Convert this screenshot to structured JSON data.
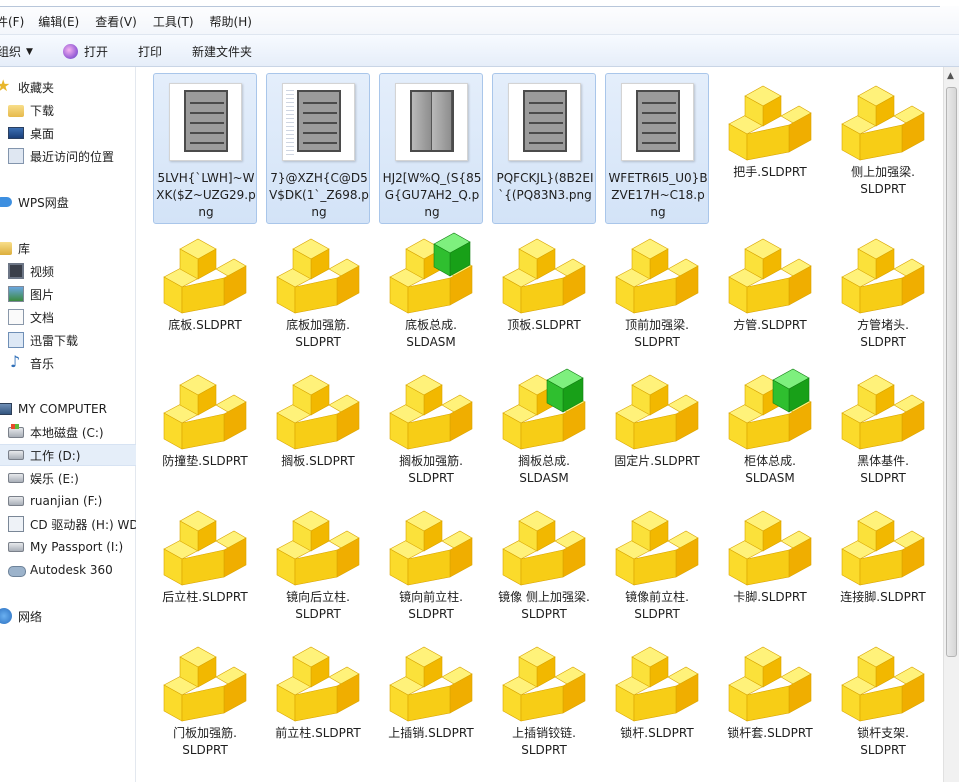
{
  "menu": [
    "件(F)",
    "编辑(E)",
    "查看(V)",
    "工具(T)",
    "帮助(H)"
  ],
  "toolbar": {
    "organize": "组织",
    "open": "打开",
    "print": "打印",
    "new_folder": "新建文件夹"
  },
  "nav": {
    "favorites": "收藏夹",
    "downloads": "下载",
    "desktop": "桌面",
    "recent": "最近访问的位置",
    "wps": "WPS网盘",
    "libraries": "库",
    "video": "视频",
    "pictures": "图片",
    "documents": "文档",
    "thunder": "迅雷下载",
    "music": "音乐",
    "computer": "MY COMPUTER",
    "drive_c": "本地磁盘 (C:)",
    "drive_d": "工作 (D:)",
    "drive_e": "娱乐 (E:)",
    "drive_f": "ruanjian (F:)",
    "drive_h": "CD 驱动器 (H:) WD",
    "drive_i": "My Passport (I:)",
    "autodesk": "Autodesk 360",
    "network": "网络"
  },
  "files": [
    {
      "name": "5LVH{`LWH]~WXK($Z~UZG29.png",
      "type": "png"
    },
    {
      "name": "7}@XZH{C@D5V$DK(1`_Z698.png",
      "type": "png"
    },
    {
      "name": "HJ2[W%Q_(S{85G{GU7AH2_Q.png",
      "type": "png"
    },
    {
      "name": "PQFCKJL}(8B2EI`{(PQ83N3.png",
      "type": "png"
    },
    {
      "name": "WFETR6I5_U0}BZVE17H~C18.png",
      "type": "png"
    },
    {
      "name": "把手.SLDPRT",
      "type": "part"
    },
    {
      "name": "侧上加强梁.SLDPRT",
      "type": "part"
    },
    {
      "name": "底板.SLDPRT",
      "type": "part"
    },
    {
      "name": "底板加强筋.SLDPRT",
      "type": "part"
    },
    {
      "name": "底板总成.SLDASM",
      "type": "asm"
    },
    {
      "name": "顶板.SLDPRT",
      "type": "part"
    },
    {
      "name": "顶前加强梁.SLDPRT",
      "type": "part"
    },
    {
      "name": "方管.SLDPRT",
      "type": "part"
    },
    {
      "name": "方管堵头.SLDPRT",
      "type": "part"
    },
    {
      "name": "防撞垫.SLDPRT",
      "type": "part"
    },
    {
      "name": "搁板.SLDPRT",
      "type": "part"
    },
    {
      "name": "搁板加强筋.SLDPRT",
      "type": "part"
    },
    {
      "name": "搁板总成.SLDASM",
      "type": "asm"
    },
    {
      "name": "固定片.SLDPRT",
      "type": "part"
    },
    {
      "name": "柜体总成.SLDASM",
      "type": "asm"
    },
    {
      "name": "黑体基件.SLDPRT",
      "type": "part"
    },
    {
      "name": "后立柱.SLDPRT",
      "type": "part"
    },
    {
      "name": "镜向后立柱.SLDPRT",
      "type": "part"
    },
    {
      "name": "镜向前立柱.SLDPRT",
      "type": "part"
    },
    {
      "name": "镜像 侧上加强梁.SLDPRT",
      "type": "part"
    },
    {
      "name": "镜像前立柱.SLDPRT",
      "type": "part"
    },
    {
      "name": "卡脚.SLDPRT",
      "type": "part"
    },
    {
      "name": "连接脚.SLDPRT",
      "type": "part"
    },
    {
      "name": "门板加强筋.SLDPRT",
      "type": "part"
    },
    {
      "name": "前立柱.SLDPRT",
      "type": "part"
    },
    {
      "name": "上插销.SLDPRT",
      "type": "part"
    },
    {
      "name": "上插销铰链.SLDPRT",
      "type": "part"
    },
    {
      "name": "锁杆.SLDPRT",
      "type": "part"
    },
    {
      "name": "锁杆套.SLDPRT",
      "type": "part"
    },
    {
      "name": "锁杆支架.SLDPRT",
      "type": "part"
    }
  ],
  "label_lines": [
    [
      "5LVH{`LWH]~W",
      "XK($Z~UZG29.p",
      "ng"
    ],
    [
      "7}@XZH{C@D5",
      "V$DK(1`_Z698.p",
      "ng"
    ],
    [
      "HJ2[W%Q_(S{85",
      "G{GU7AH2_Q.p",
      "ng"
    ],
    [
      "PQFCKJL}(8B2EI",
      "`{(PQ83N3.png"
    ],
    [
      "WFETR6I5_U0}B",
      "ZVE17H~C18.p",
      "ng"
    ],
    [
      "把手.SLDPRT"
    ],
    [
      "侧上加强梁.",
      "SLDPRT"
    ],
    [
      "底板.SLDPRT"
    ],
    [
      "底板加强筋.",
      "SLDPRT"
    ],
    [
      "底板总成.",
      "SLDASM"
    ],
    [
      "顶板.SLDPRT"
    ],
    [
      "顶前加强梁.",
      "SLDPRT"
    ],
    [
      "方管.SLDPRT"
    ],
    [
      "方管堵头.",
      "SLDPRT"
    ],
    [
      "防撞垫.SLDPRT"
    ],
    [
      "搁板.SLDPRT"
    ],
    [
      "搁板加强筋.",
      "SLDPRT"
    ],
    [
      "搁板总成.",
      "SLDASM"
    ],
    [
      "固定片.SLDPRT"
    ],
    [
      "柜体总成.",
      "SLDASM"
    ],
    [
      "黑体基件.",
      "SLDPRT"
    ],
    [
      "后立柱.SLDPRT"
    ],
    [
      "镜向后立柱.",
      "SLDPRT"
    ],
    [
      "镜向前立柱.",
      "SLDPRT"
    ],
    [
      "镜像 侧上加强梁.",
      "SLDPRT"
    ],
    [
      "镜像前立柱.",
      "SLDPRT"
    ],
    [
      "卡脚.SLDPRT"
    ],
    [
      "连接脚.SLDPRT"
    ],
    [
      "门板加强筋.",
      "SLDPRT"
    ],
    [
      "前立柱.SLDPRT"
    ],
    [
      "上插销.SLDPRT"
    ],
    [
      "上插销铰链.",
      "SLDPRT"
    ],
    [
      "锁杆.SLDPRT"
    ],
    [
      "锁杆套.SLDPRT"
    ],
    [
      "锁杆支架.",
      "SLDPRT"
    ]
  ],
  "colors": {
    "part_yellow": "#f7d21b",
    "asm_green": "#2fbf2f",
    "selection": "#d3e3f7"
  }
}
